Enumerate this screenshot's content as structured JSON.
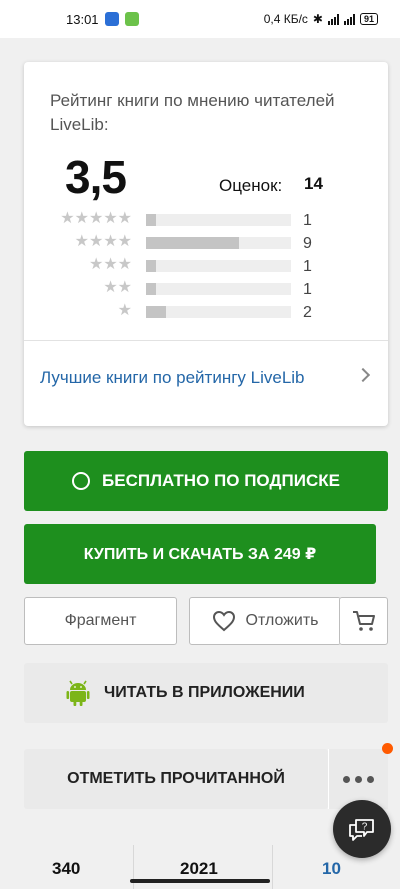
{
  "status_bar": {
    "time": "13:01",
    "net_speed": "0,4 КБ/с",
    "battery": "91"
  },
  "rating_card": {
    "title": "Рейтинг книги по мнению читателей LiveLib:",
    "score": "3,5",
    "count_label": "Оценок:",
    "count": "14",
    "distribution": [
      {
        "stars": "★★★★★",
        "value": "1",
        "fraction": 0.07
      },
      {
        "stars": "★★★★",
        "value": "9",
        "fraction": 0.64
      },
      {
        "stars": "★★★",
        "value": "1",
        "fraction": 0.07
      },
      {
        "stars": "★★",
        "value": "1",
        "fraction": 0.07
      },
      {
        "stars": "★",
        "value": "2",
        "fraction": 0.14
      }
    ],
    "link": "Лучшие книги по рейтингу LiveLib"
  },
  "actions": {
    "subscription": "БЕСПЛАТНО ПО ПОДПИСКЕ",
    "buy": "КУПИТЬ И СКАЧАТЬ ЗА 249 ₽",
    "fragment": "Фрагмент",
    "later": "Отложить",
    "read_in_app": "ЧИТАТЬ В ПРИЛОЖЕНИИ",
    "mark_read": "ОТМЕТИТЬ ПРОЧИТАННОЙ"
  },
  "stats": [
    "340",
    "2021",
    "10"
  ],
  "colors": {
    "green": "#1e8f1e",
    "link": "#2467a8",
    "notify": "#ff5a00"
  }
}
